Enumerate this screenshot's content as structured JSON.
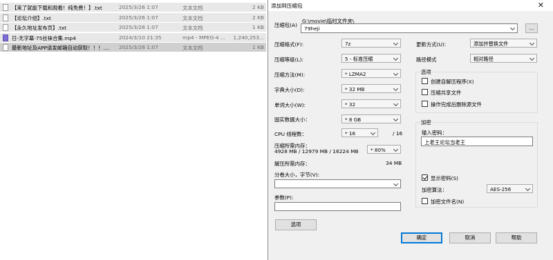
{
  "explorer": {
    "files": [
      {
        "name": "【来了就能下载和观看！纯免费！】.txt",
        "date": "2025/3/26 1:07",
        "type": "文本文档",
        "size": "2 KB",
        "icon": "txt"
      },
      {
        "name": "【论坛介绍】.txt",
        "date": "2025/3/26 1:07",
        "type": "文本文档",
        "size": "2 KB",
        "icon": "txt"
      },
      {
        "name": "【永久地址发布页】.txt",
        "date": "2025/3/26 1:07",
        "type": "文本文档",
        "size": "1 KB",
        "icon": "txt"
      },
      {
        "name": "日-无字幕-75丝袜合集.mp4",
        "date": "2024/3/10 21:35",
        "type": "mp4 - MPEG-4 ...",
        "size": "1,240,253...",
        "icon": "video"
      },
      {
        "name": "最新地址及APP请发邮箱自动获取！！！....",
        "date": "2025/3/26 1:07",
        "type": "文本文档",
        "size": "1 KB",
        "icon": "txt"
      }
    ]
  },
  "dialog": {
    "title": "添加到压缩包",
    "close": "✕",
    "archive": {
      "label": "压缩包(A)",
      "path": "G:\\movie\\临时文件夹\\",
      "value": "79heji",
      "browse": "..."
    },
    "format": {
      "label": "压缩格式(F):",
      "value": "7z"
    },
    "level": {
      "label": "压缩等级(L):",
      "value": "5 - 标准压缩"
    },
    "method": {
      "label": "压缩方法(M):",
      "value": "* LZMA2"
    },
    "dict": {
      "label": "字典大小(D):",
      "value": "* 32 MB"
    },
    "word": {
      "label": "单词大小(W):",
      "value": "* 32"
    },
    "solid": {
      "label": "固实数据大小：",
      "value": "* 8 GB"
    },
    "cpu": {
      "label": "CPU 线程数：",
      "value": "* 16",
      "total": "/ 16"
    },
    "memory": {
      "label": "压缩所需内存：",
      "detail": "4928 MB / 12979 MB / 16224 MB",
      "value": "* 80%"
    },
    "decompress": {
      "label": "解压所需内存：",
      "value": "34 MB"
    },
    "split": {
      "label": "分卷大小，字节(V):",
      "value": ""
    },
    "params": {
      "label": "参数(P):",
      "value": ""
    },
    "options_button": "选项",
    "update": {
      "label": "更新方式(U):",
      "value": "添加并替换文件"
    },
    "pathmode": {
      "label": "路径模式",
      "value": "相对路径"
    },
    "options_group": {
      "title": "选项",
      "items": [
        {
          "label": "创建自解压程序(X)",
          "checked": false
        },
        {
          "label": "压缩共享文件",
          "checked": false
        },
        {
          "label": "操作完成后删除源文件",
          "checked": false
        }
      ]
    },
    "encryption": {
      "title": "加密",
      "password_label": "输入密码：",
      "password_value": "上老王论坛当老王",
      "show_password": {
        "label": "显示密码(S)",
        "checked": true
      },
      "method_label": "加密算法：",
      "method_value": "AES-256",
      "encrypt_names": {
        "label": "加密文件名(N)",
        "checked": false
      }
    },
    "buttons": {
      "ok": "确定",
      "cancel": "取消",
      "help": "帮助"
    }
  }
}
